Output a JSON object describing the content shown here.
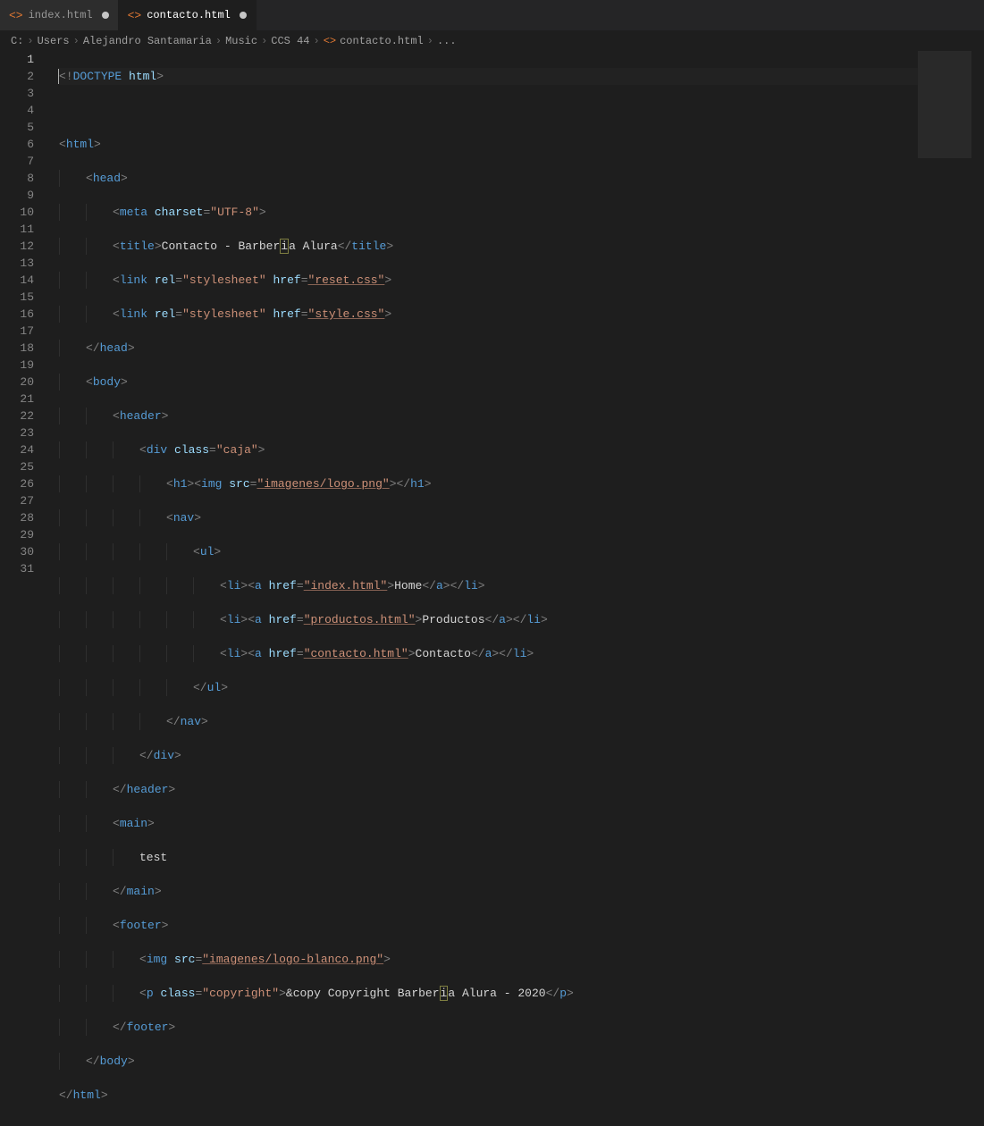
{
  "tabs": [
    {
      "label": "index.html",
      "modified": true,
      "active": false
    },
    {
      "label": "contacto.html",
      "modified": true,
      "active": true
    }
  ],
  "breadcrumbs": {
    "parts": [
      "C:",
      "Users",
      "Alejandro Santamaria",
      "Music",
      "CCS 44"
    ],
    "file": "contacto.html",
    "trailing": "..."
  },
  "code": {
    "lines": 31,
    "l1_doctype": "DOCTYPE",
    "l1_html": "html",
    "l3_html": "html",
    "l4_head": "head",
    "l5_meta": "meta",
    "l5_charset_attr": "charset",
    "l5_charset_val": "\"UTF-8\"",
    "l6_title": "title",
    "l6_text_a": "Contacto - Barber",
    "l6_text_i": "i",
    "l6_text_b": "a Alura",
    "l7_link": "link",
    "l7_rel_attr": "rel",
    "l7_rel_val": "\"stylesheet\"",
    "l7_href_attr": "href",
    "l7_href_val": "\"reset.css\"",
    "l8_link": "link",
    "l8_href_val": "\"style.css\"",
    "l9_head_close": "head",
    "l10_body": "body",
    "l11_header": "header",
    "l12_div": "div",
    "l12_class_attr": "class",
    "l12_class_val": "\"caja\"",
    "l13_h1": "h1",
    "l13_img": "img",
    "l13_src_attr": "src",
    "l13_src_val": "\"imagenes/logo.png\"",
    "l14_nav": "nav",
    "l15_ul": "ul",
    "l16_li": "li",
    "l16_a": "a",
    "l16_href_attr": "href",
    "l16_href_val": "\"index.html\"",
    "l16_text": "Home",
    "l17_href_val": "\"productos.html\"",
    "l17_text": "Productos",
    "l18_href_val": "\"contacto.html\"",
    "l18_text": "Contacto",
    "l19_ul_close": "ul",
    "l20_nav_close": "nav",
    "l21_div_close": "div",
    "l22_header_close": "header",
    "l23_main": "main",
    "l24_text": "test",
    "l25_main_close": "main",
    "l26_footer": "footer",
    "l27_img": "img",
    "l27_src_val": "\"imagenes/logo-blanco.png\"",
    "l28_p": "p",
    "l28_class_val": "\"copyright\"",
    "l28_text_a": "&copy Copyright Barber",
    "l28_text_i": "i",
    "l28_text_b": "a Alura - 2020",
    "l29_footer_close": "footer",
    "l30_body_close": "body",
    "l31_html_close": "html"
  }
}
